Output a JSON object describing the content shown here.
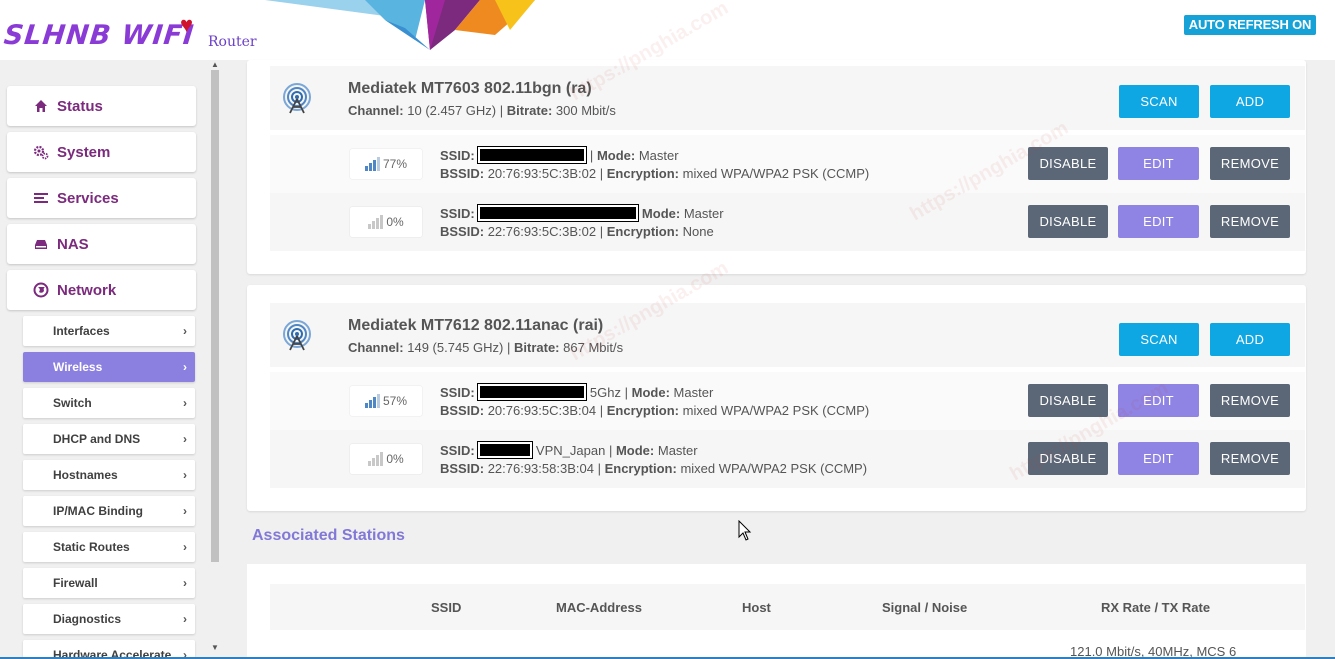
{
  "header": {
    "logo_text": "SLHNB WIFI",
    "logo_sub": "Router",
    "auto_refresh": "AUTO REFRESH ON"
  },
  "sidebar": {
    "main": [
      {
        "label": "Status",
        "icon": "home-icon"
      },
      {
        "label": "System",
        "icon": "gears-icon"
      },
      {
        "label": "Services",
        "icon": "list-icon"
      },
      {
        "label": "NAS",
        "icon": "drive-icon"
      },
      {
        "label": "Network",
        "icon": "globe-icon"
      }
    ],
    "sub": [
      {
        "label": "Interfaces",
        "active": false
      },
      {
        "label": "Wireless",
        "active": true
      },
      {
        "label": "Switch",
        "active": false
      },
      {
        "label": "DHCP and DNS",
        "active": false
      },
      {
        "label": "Hostnames",
        "active": false
      },
      {
        "label": "IP/MAC Binding",
        "active": false
      },
      {
        "label": "Static Routes",
        "active": false
      },
      {
        "label": "Firewall",
        "active": false
      },
      {
        "label": "Diagnostics",
        "active": false
      },
      {
        "label": "Hardware Accelerate",
        "active": false
      }
    ]
  },
  "radios": [
    {
      "name": "Mediatek MT7603 802.11bgn (ra)",
      "channel_label": "Channel:",
      "channel_value": "10 (2.457 GHz)",
      "bitrate_label": "Bitrate:",
      "bitrate_value": "300 Mbit/s",
      "scan": "SCAN",
      "add": "ADD",
      "networks": [
        {
          "signal": "77%",
          "ssid_suffix": "",
          "mode": "Master",
          "bssid": "20:76:93:5C:3B:02",
          "encryption": "mixed WPA/WPA2 PSK (CCMP)"
        },
        {
          "signal": "0%",
          "ssid_suffix": "",
          "mode": "Master",
          "bssid": "22:76:93:5C:3B:02",
          "encryption": "None"
        }
      ]
    },
    {
      "name": "Mediatek MT7612 802.11anac (rai)",
      "channel_label": "Channel:",
      "channel_value": "149 (5.745 GHz)",
      "bitrate_label": "Bitrate:",
      "bitrate_value": "867 Mbit/s",
      "scan": "SCAN",
      "add": "ADD",
      "networks": [
        {
          "signal": "57%",
          "ssid_suffix": "5Ghz",
          "mode": "Master",
          "bssid": "20:76:93:5C:3B:04",
          "encryption": "mixed WPA/WPA2 PSK (CCMP)"
        },
        {
          "signal": "0%",
          "ssid_suffix": "VPN_Japan",
          "mode": "Master",
          "bssid": "22:76:93:58:3B:04",
          "encryption": "mixed WPA/WPA2 PSK (CCMP)"
        }
      ]
    }
  ],
  "labels": {
    "ssid": "SSID:",
    "mode": "Mode:",
    "bssid": "BSSID:",
    "encryption": "Encryption:",
    "disable": "DISABLE",
    "edit": "EDIT",
    "remove": "REMOVE",
    "sep": "|"
  },
  "stations": {
    "title": "Associated Stations",
    "columns": [
      "SSID",
      "MAC-Address",
      "Host",
      "Signal / Noise",
      "RX Rate / TX Rate"
    ],
    "first_row_rate": "121.0 Mbit/s, 40MHz, MCS 6"
  },
  "watermark": "https://pnghia.com",
  "colors": {
    "accent": "#8b7fe0",
    "primary_button": "#0ea7e3",
    "dark_button": "#5b6776",
    "nav_text": "#7b2a7d",
    "title_text": "#8178d8"
  }
}
